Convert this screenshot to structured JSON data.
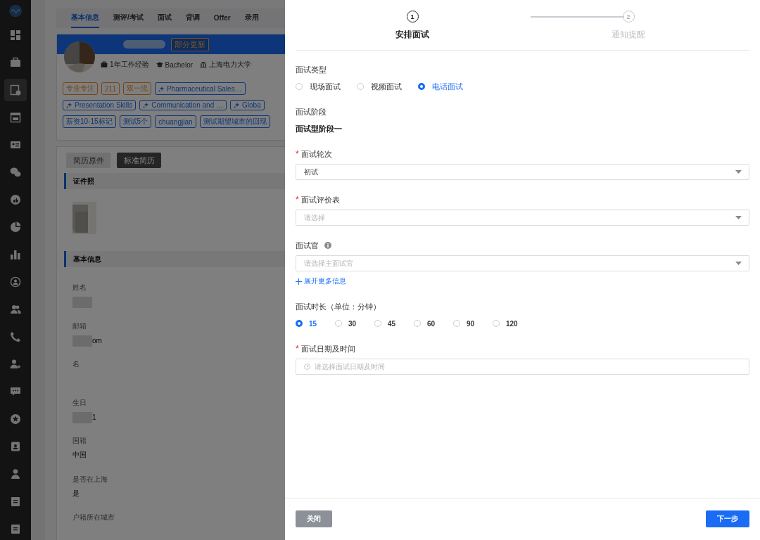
{
  "sidebar": {
    "items": [
      {
        "kind": "grid",
        "selected": false
      },
      {
        "kind": "briefcase",
        "selected": false
      },
      {
        "kind": "resume",
        "selected": true
      },
      {
        "kind": "calendar",
        "selected": false
      },
      {
        "kind": "card",
        "selected": false
      },
      {
        "kind": "chat2",
        "selected": false
      },
      {
        "kind": "thumb",
        "selected": false
      },
      {
        "kind": "pie",
        "selected": false
      },
      {
        "kind": "bars",
        "selected": false
      },
      {
        "kind": "usercircle",
        "selected": false
      },
      {
        "kind": "users",
        "selected": false
      },
      {
        "kind": "phone",
        "selected": false
      },
      {
        "kind": "userstar",
        "selected": false
      },
      {
        "kind": "chat",
        "selected": false
      },
      {
        "kind": "star",
        "selected": false
      },
      {
        "kind": "badge",
        "selected": false
      },
      {
        "kind": "user",
        "selected": false
      },
      {
        "kind": "clipboard",
        "selected": false
      },
      {
        "kind": "clipboard",
        "selected": false
      }
    ]
  },
  "page": {
    "tabs": [
      {
        "label": "基本信息",
        "selected": true
      },
      {
        "label": "测评/考试",
        "selected": false
      },
      {
        "label": "面试",
        "selected": false
      },
      {
        "label": "背调",
        "selected": false
      },
      {
        "label": "Offer",
        "selected": false
      },
      {
        "label": "录用",
        "selected": false
      }
    ],
    "profile": {
      "badge": "部分更新",
      "facts": [
        {
          "kind": "work",
          "text": "1年工作经验"
        },
        {
          "kind": "degree",
          "text": "Bachelor"
        },
        {
          "kind": "school",
          "text": "上海电力大学"
        }
      ],
      "tag_rows": [
        [
          {
            "kind": "highlight",
            "text": "专业专注"
          },
          {
            "kind": "highlight",
            "text": "211"
          },
          {
            "kind": "highlight",
            "text": "双一流"
          },
          {
            "kind": "skill",
            "text": "Pharmaceutical Sales…"
          }
        ],
        [
          {
            "kind": "skill",
            "text": "Presentation Skills"
          },
          {
            "kind": "skill",
            "text": "Communication and …"
          },
          {
            "kind": "skill",
            "text": "Globa"
          }
        ],
        [
          {
            "kind": "plain",
            "text": "薪资10-15标记"
          },
          {
            "kind": "plain",
            "text": "测试5个"
          },
          {
            "kind": "plain",
            "text": "chuangjian"
          },
          {
            "kind": "plain",
            "text": "测试期望城市的回现"
          }
        ]
      ]
    },
    "resume_tabs": [
      {
        "label": "简历原件",
        "selected": false
      },
      {
        "label": "标准简历",
        "selected": true
      }
    ],
    "sections": [
      {
        "title": "证件照"
      },
      {
        "kind": "fields",
        "title": "基本信息",
        "fields": [
          {
            "label": "姓名",
            "redacted": true
          },
          {
            "label": "邮箱",
            "redacted": true,
            "value": "om"
          },
          {
            "label": "名"
          },
          {
            "label": "生日",
            "redacted": true,
            "value": "1"
          },
          {
            "label": "国籍",
            "value": "中国"
          },
          {
            "label": "是否在上海",
            "value": "是"
          },
          {
            "label": "户籍所在城市"
          }
        ]
      }
    ]
  },
  "drawer": {
    "steps": [
      {
        "number": "1",
        "label": "安排面试",
        "selected": true
      },
      {
        "number": "2",
        "label": "通知提醒",
        "selected": false
      }
    ],
    "fields": [
      {
        "kind": "radio",
        "label": "面试类型",
        "options": [
          {
            "label": "现场面试",
            "selected": false
          },
          {
            "label": "视频面试",
            "selected": false
          },
          {
            "label": "电话面试",
            "selected": true
          }
        ]
      },
      {
        "kind": "static",
        "label": "面试阶段",
        "value": "面试型阶段一"
      },
      {
        "kind": "select",
        "label": "面试轮次",
        "required_mark": "*",
        "value": "初试"
      },
      {
        "kind": "select",
        "label": "面试评价表",
        "required_mark": "*",
        "placeholder": "请选择"
      },
      {
        "kind": "select",
        "label": "面试官",
        "info": true,
        "placeholder": "请选择主面试官"
      },
      {
        "kind": "link",
        "text": "展开更多信息"
      },
      {
        "kind": "radio",
        "label": "面试时长（单位：分钟）",
        "options": [
          {
            "label": "15",
            "selected": true
          },
          {
            "label": "30",
            "selected": false
          },
          {
            "label": "45",
            "selected": false
          },
          {
            "label": "60",
            "selected": false
          },
          {
            "label": "90",
            "selected": false
          },
          {
            "label": "120",
            "selected": false
          }
        ]
      },
      {
        "kind": "datetime",
        "label": "面试日期及时间",
        "required_mark": "*",
        "placeholder": "请选择面试日期及时间"
      }
    ],
    "buttons": [
      {
        "kind": "secondary",
        "label": "关闭"
      },
      {
        "kind": "primary",
        "label": "下一步"
      }
    ]
  }
}
